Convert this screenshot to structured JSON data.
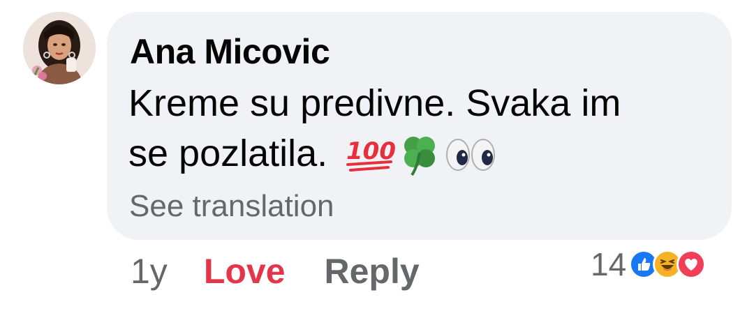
{
  "comment": {
    "author": "Ana Micovic",
    "text_line1": "Kreme su predivne. Svaka im",
    "text_line2": "se pozlatila.",
    "emojis": [
      "hundred-points",
      "four-leaf-clover",
      "eyes"
    ],
    "see_translation": "See translation"
  },
  "actions": {
    "time": "1y",
    "love_label": "Love",
    "reply_label": "Reply"
  },
  "reactions": {
    "count": "14",
    "types": [
      "like",
      "haha",
      "love"
    ]
  },
  "colors": {
    "bubble": "#f0f2f5",
    "author_text": "#050505",
    "secondary_text": "#65676b",
    "love_red": "#e4364a",
    "like_blue": "#1877f2",
    "haha_yellow": "#f7b125"
  }
}
